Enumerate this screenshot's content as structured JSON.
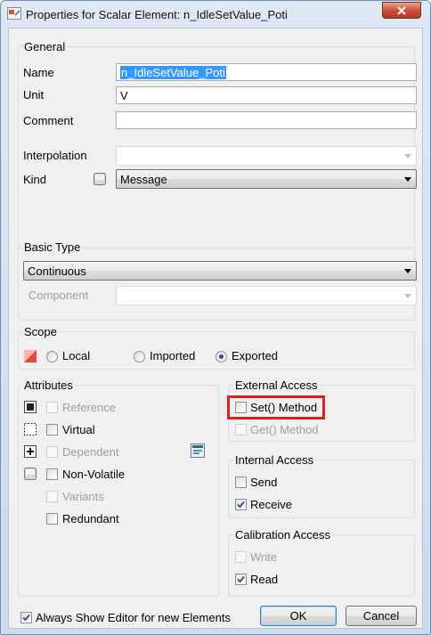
{
  "window": {
    "title": "Properties for Scalar Element: n_IdleSetValue_Poti"
  },
  "general": {
    "legend": "General",
    "name_label": "Name",
    "name_value": "n_IdleSetValue_Poti",
    "unit_label": "Unit",
    "unit_value": "V",
    "comment_label": "Comment",
    "comment_value": "",
    "interpolation_label": "Interpolation",
    "interpolation_value": "",
    "kind_label": "Kind",
    "kind_value": "Message"
  },
  "basic_type": {
    "legend": "Basic Type",
    "type_value": "Continuous",
    "component_label": "Component",
    "component_value": ""
  },
  "scope": {
    "legend": "Scope",
    "options": [
      "Local",
      "Imported",
      "Exported"
    ],
    "selected": "Exported"
  },
  "attributes": {
    "legend": "Attributes",
    "reference": "Reference",
    "virtual": "Virtual",
    "dependent": "Dependent",
    "non_volatile": "Non-Volatile",
    "variants": "Variants",
    "redundant": "Redundant"
  },
  "external_access": {
    "legend": "External Access",
    "set_method": "Set() Method",
    "get_method": "Get() Method"
  },
  "internal_access": {
    "legend": "Internal Access",
    "send": "Send",
    "receive": "Receive"
  },
  "calibration_access": {
    "legend": "Calibration Access",
    "write": "Write",
    "read": "Read"
  },
  "footer": {
    "always_show": "Always Show Editor for new Elements",
    "ok": "OK",
    "cancel": "Cancel"
  },
  "colors": {
    "highlight": "#e02020",
    "selection": "#3399ff",
    "radio_dot": "#1f4f95"
  }
}
